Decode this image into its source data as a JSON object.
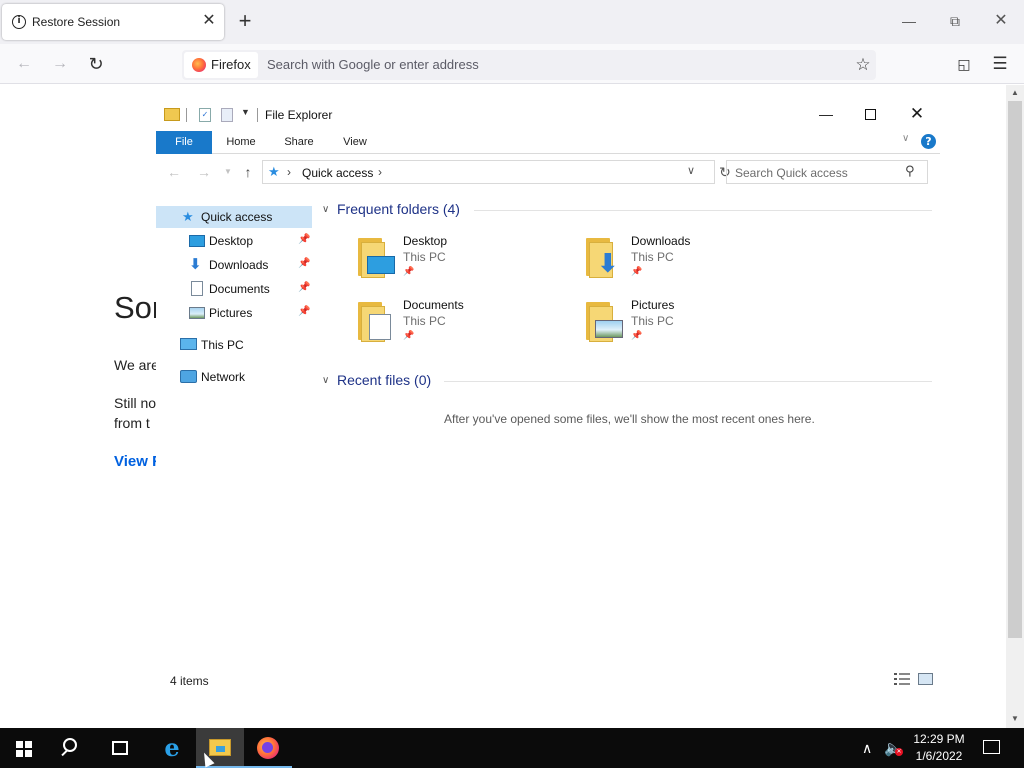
{
  "browser": {
    "tab_title": "Restore Session",
    "tab_close": "✕",
    "new_tab": "+",
    "identity_label": "Firefox",
    "url_placeholder": "Search with Google or enter address"
  },
  "background_page": {
    "heading": "Sor",
    "line1": "We are",
    "line2a": "Still no",
    "line2b": "from t",
    "link": "View F"
  },
  "explorer": {
    "title": "File Explorer",
    "ribbon_tabs": [
      "File",
      "Home",
      "Share",
      "View"
    ],
    "address_path": "Quick access",
    "search_placeholder": "Search Quick access",
    "nav": [
      {
        "label": "Quick access",
        "icon": "star-icon",
        "pinned": false
      },
      {
        "label": "Desktop",
        "icon": "desktop-icon",
        "pinned": true
      },
      {
        "label": "Downloads",
        "icon": "download-icon",
        "pinned": true
      },
      {
        "label": "Documents",
        "icon": "document-icon",
        "pinned": true
      },
      {
        "label": "Pictures",
        "icon": "pictures-icon",
        "pinned": true
      },
      {
        "label": "This PC",
        "icon": "computer-icon",
        "pinned": false
      },
      {
        "label": "Network",
        "icon": "network-icon",
        "pinned": false
      }
    ],
    "frequent_header": "Frequent folders (4)",
    "folders": [
      {
        "name": "Desktop",
        "location": "This PC"
      },
      {
        "name": "Downloads",
        "location": "This PC"
      },
      {
        "name": "Documents",
        "location": "This PC"
      },
      {
        "name": "Pictures",
        "location": "This PC"
      }
    ],
    "recent_header": "Recent files (0)",
    "recent_empty": "After you've opened some files, we'll show the most recent ones here.",
    "status": "4 items"
  },
  "taskbar": {
    "time": "12:29 PM",
    "date": "1/6/2022"
  },
  "colors": {
    "ribbon_file": "#1979ca",
    "nav_selected": "#cce4f7",
    "group_header": "#1e3287",
    "link": "#0061e0"
  }
}
